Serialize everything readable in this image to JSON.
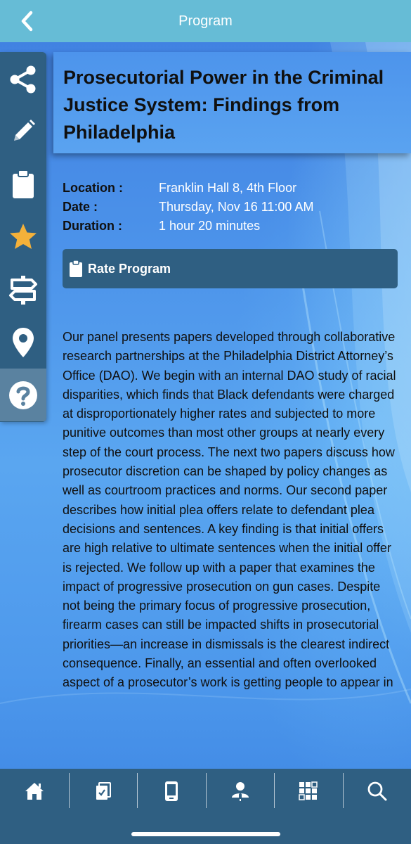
{
  "header": {
    "title": "Program"
  },
  "rail": {
    "items": [
      {
        "icon": "share-icon"
      },
      {
        "icon": "pencil-icon"
      },
      {
        "icon": "clipboard-icon"
      },
      {
        "icon": "star-icon",
        "color": "#f4b13a"
      },
      {
        "icon": "signpost-icon"
      },
      {
        "icon": "map-pin-icon"
      },
      {
        "icon": "help-icon"
      }
    ]
  },
  "program": {
    "title": "Prosecutorial Power in the Criminal Justice System: Findings from Philadelphia",
    "details": [
      {
        "label": "Location :",
        "value": "Franklin Hall 8, 4th Floor"
      },
      {
        "label": "Date :",
        "value": "Thursday, Nov 16 11:00 AM"
      },
      {
        "label": "Duration :",
        "value": "1 hour 20 minutes"
      }
    ],
    "rate_label": "Rate Program",
    "description": "Our panel presents papers developed through collaborative research partnerships at the Philadelphia District Attorney’s Office (DAO). We begin with an internal DAO study of racial disparities, which finds that Black defendants were charged at disproportionately higher rates and subjected to more punitive outcomes than most other groups at nearly every step of the court process. The next two papers discuss how prosecutor discretion can be shaped by policy changes as well as courtroom practices and norms. Our second paper describes how initial plea offers relate to defendant plea decisions and sentences. A key finding is that initial offers are high relative to ultimate sentences when the initial offer is rejected. We follow up with a paper that examines the impact of progressive prosecution on gun cases. Despite not being the primary focus of progressive prosecution, firearm cases can still be impacted shifts in prosecutorial priorities—an increase in dismissals is the clearest indirect consequence. Finally, an essential and often overlooked aspect of a prosecutor’s work is getting people to appear in"
  },
  "tabbar": {
    "tabs": [
      {
        "icon": "home-icon"
      },
      {
        "icon": "documents-icon"
      },
      {
        "icon": "mobile-device-icon"
      },
      {
        "icon": "speaker-icon"
      },
      {
        "icon": "grid-apps-icon"
      },
      {
        "icon": "search-icon"
      }
    ]
  },
  "colors": {
    "header": "#66bcd6",
    "panel": "#2f5f82",
    "accent_star": "#f4b13a"
  }
}
